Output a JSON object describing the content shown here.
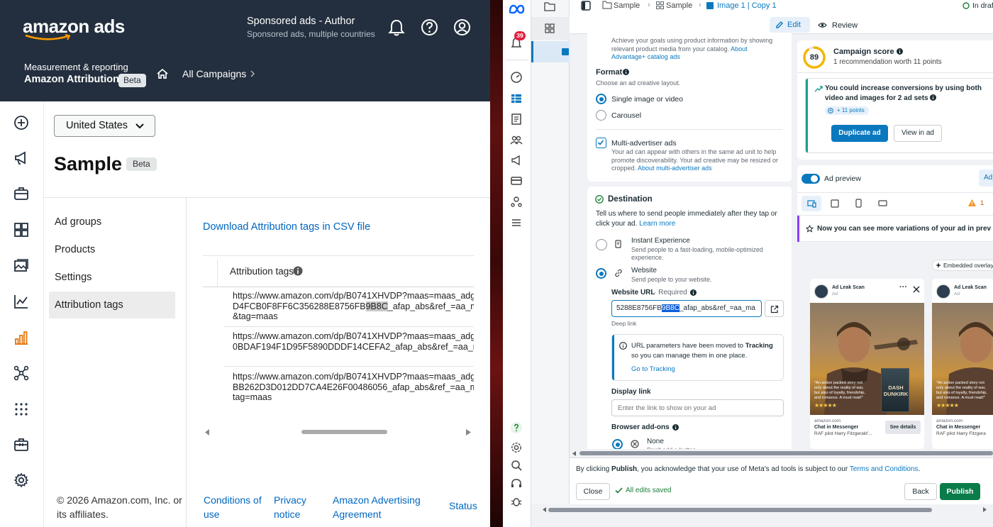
{
  "amazon": {
    "logo": "amazon ads",
    "account_name": "Sponsored ads - Author",
    "account_sub": "Sponsored ads, multiple countries",
    "breadcrumb_section": "Measurement & reporting",
    "breadcrumb_product": "Amazon Attribution",
    "beta_badge": "Beta",
    "all_campaigns": "All Campaigns",
    "country_select": "United States",
    "page_title": "Sample",
    "page_beta": "Beta",
    "nav": [
      "Ad groups",
      "Products",
      "Settings",
      "Attribution tags"
    ],
    "download_link": "Download Attribution tags in CSV file",
    "table_header": "Attribution tags",
    "rows": [
      {
        "l1": "https://www.amazon.com/dp/B0741XHVDP?maas=maas_adg",
        "l2a": "D4FCB0F8FF6C356288E8756FB",
        "l2b": "9B8C",
        "l2c": "_afap_abs&ref_=aa_m",
        "l3": "&tag=maas"
      },
      {
        "l1": "https://www.amazon.com/dp/B0741XHVDP?maas=maas_adg",
        "l2a": "0BDAF194F1D95F5890DDDF14CEFA2_afap_abs&ref_=aa_m",
        "l2b": "",
        "l2c": "",
        "l3": ""
      },
      {
        "l1": "https://www.amazon.com/dp/B0741XHVDP?maas=maas_adg",
        "l2a": "BB262D3D012DD7CA4E26F00486056_afap_abs&ref_=aa_m",
        "l2b": "",
        "l2c": "",
        "l3": "tag=maas"
      }
    ],
    "footer_copyright": "© 2026 Amazon.com, Inc. or its affiliates.",
    "footer_links": [
      "Conditions of use",
      "Privacy notice",
      "Amazon Advertising Agreement",
      "Status"
    ]
  },
  "meta": {
    "notif_count": "39",
    "breadcrumb": [
      "Sample",
      "Sample",
      "Image 1 | Copy 1"
    ],
    "status": "In draft",
    "edit_tab": "Edit",
    "review_tab": "Review",
    "top_desc": "Achieve your goals using product information by showing relevant product media from your catalog.",
    "top_desc_link": "About Advantage+ catalog ads",
    "format_title": "Format",
    "format_sub": "Choose an ad creative layout.",
    "format_opt1": "Single image or video",
    "format_opt2": "Carousel",
    "multi_title": "Multi-advertiser ads",
    "multi_desc": "Your ad can appear with others in the same ad unit to help promote discoverability. Your ad creative may be resized or cropped.",
    "multi_link": "About multi-advertiser ads",
    "dest_title": "Destination",
    "dest_desc": "Tell us where to send people immediately after they tap or click your ad.",
    "dest_learn": "Learn more",
    "instant_title": "Instant Experience",
    "instant_sub": "Send people to a fast-loading, mobile-optimized experience.",
    "website_title": "Website",
    "website_sub": "Send people to your website.",
    "url_label": "Website URL",
    "url_required": "· Required",
    "url_value_a": "5288E8756FB",
    "url_value_sel": "9B8C",
    "url_value_b": "_afap_abs&ref_=aa_ma",
    "deep_link": "Deep link",
    "tracking_msg_a": "URL parameters have been moved to",
    "tracking_msg_b": "Tracking",
    "tracking_msg_c": "so you can manage them in one place.",
    "go_tracking": "Go to Tracking",
    "display_link_title": "Display link",
    "display_link_placeholder": "Enter the link to show on your ad",
    "addons_title": "Browser add-ons",
    "addon_none": "None",
    "addon_none_sub": "Don't add a button",
    "score_value": "89",
    "score_title": "Campaign score",
    "score_sub": "1 recommendation worth 11 points",
    "rec_title": "You could increase conversions by using both video and images for 2 ad sets",
    "rec_points": "+ 11 points",
    "dup_btn": "Duplicate ad",
    "view_btn": "View in ad",
    "preview_label": "Ad preview",
    "preview_adv": "Ad",
    "warn_count": "1",
    "variations_msg": "Now you can see more variations of your ad in prev",
    "overlay_label": "Embedded overlay",
    "ad_name": "Ad Leak Scan",
    "ad_tag": "Ad",
    "ad_quote": "\"An action packed story not only about the reality of war, but also of loyalty, friendship, and romance. A must read!\"",
    "book_title": "DASH DUNKIRK",
    "ad_domain": "amazon.com",
    "ad_cta": "Chat in Messenger",
    "ad_caption": "RAF pilot Harry Fitzgerald'...",
    "ad_details": "See details",
    "ad_caption2": "RAF pilot Harry Fitzgera",
    "consent_a": "By clicking",
    "consent_b": "Publish",
    "consent_c": ", you acknowledge that your use of Meta's ad tools is subject to our",
    "consent_link": "Terms and Conditions",
    "close_btn": "Close",
    "saved_msg": "All edits saved",
    "back_btn": "Back",
    "publish_btn": "Publish",
    "colors": {
      "amazon_header": "#232f3e",
      "amazon_link": "#0066c0",
      "meta_blue": "#0a78be",
      "meta_green": "#0a7c4a"
    }
  }
}
